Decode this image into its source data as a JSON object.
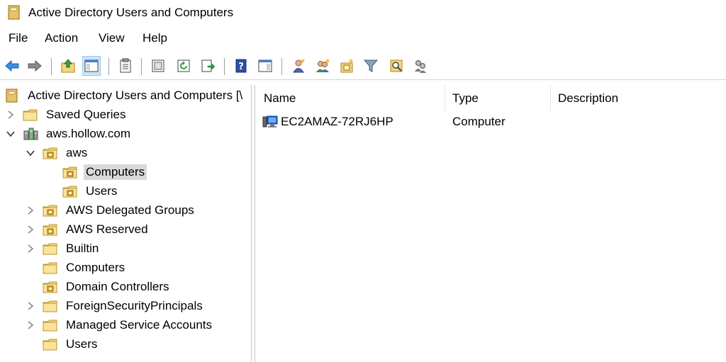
{
  "window": {
    "title": "Active Directory Users and Computers"
  },
  "menu": [
    "File",
    "Action",
    "View",
    "Help"
  ],
  "toolbar": {
    "buttons": [
      "back-arrow-icon",
      "forward-arrow-icon",
      "up-folder-icon",
      "show-hide-console-tree-icon",
      "properties-icon",
      "export-list-icon",
      "refresh-icon",
      "export-icon",
      "help-icon",
      "show-action-pane-icon",
      "new-user-icon",
      "new-group-icon",
      "new-ou-icon",
      "filter-icon",
      "find-icon",
      "add-to-group-icon"
    ]
  },
  "tree": {
    "root": "Active Directory Users and Computers [\\",
    "items": [
      {
        "label": "Saved Queries",
        "level": 1,
        "expander": "collapsed",
        "icon": "folder"
      },
      {
        "label": "aws.hollow.com",
        "level": 1,
        "expander": "expanded",
        "icon": "domain"
      },
      {
        "label": "aws",
        "level": 2,
        "expander": "expanded",
        "icon": "ou"
      },
      {
        "label": "Computers",
        "level": 3,
        "expander": "none",
        "icon": "ou",
        "selected": true
      },
      {
        "label": "Users",
        "level": 3,
        "expander": "none",
        "icon": "ou"
      },
      {
        "label": "AWS Delegated Groups",
        "level": 2,
        "expander": "collapsed",
        "icon": "ou"
      },
      {
        "label": "AWS Reserved",
        "level": 2,
        "expander": "collapsed",
        "icon": "ou"
      },
      {
        "label": "Builtin",
        "level": 2,
        "expander": "collapsed",
        "icon": "folder"
      },
      {
        "label": "Computers",
        "level": 2,
        "expander": "none",
        "icon": "folder"
      },
      {
        "label": "Domain Controllers",
        "level": 2,
        "expander": "none",
        "icon": "ou"
      },
      {
        "label": "ForeignSecurityPrincipals",
        "level": 2,
        "expander": "collapsed",
        "icon": "folder"
      },
      {
        "label": "Managed Service Accounts",
        "level": 2,
        "expander": "collapsed",
        "icon": "folder"
      },
      {
        "label": "Users",
        "level": 2,
        "expander": "none",
        "icon": "folder"
      }
    ]
  },
  "list": {
    "columns": [
      "Name",
      "Type",
      "Description"
    ],
    "rows": [
      {
        "name": "EC2AMAZ-72RJ6HP",
        "type": "Computer",
        "description": ""
      }
    ]
  },
  "colors": {
    "selection": "#d9d9d9",
    "folder": "#f5d77b",
    "toolbar_selected": "#cce4f7"
  }
}
